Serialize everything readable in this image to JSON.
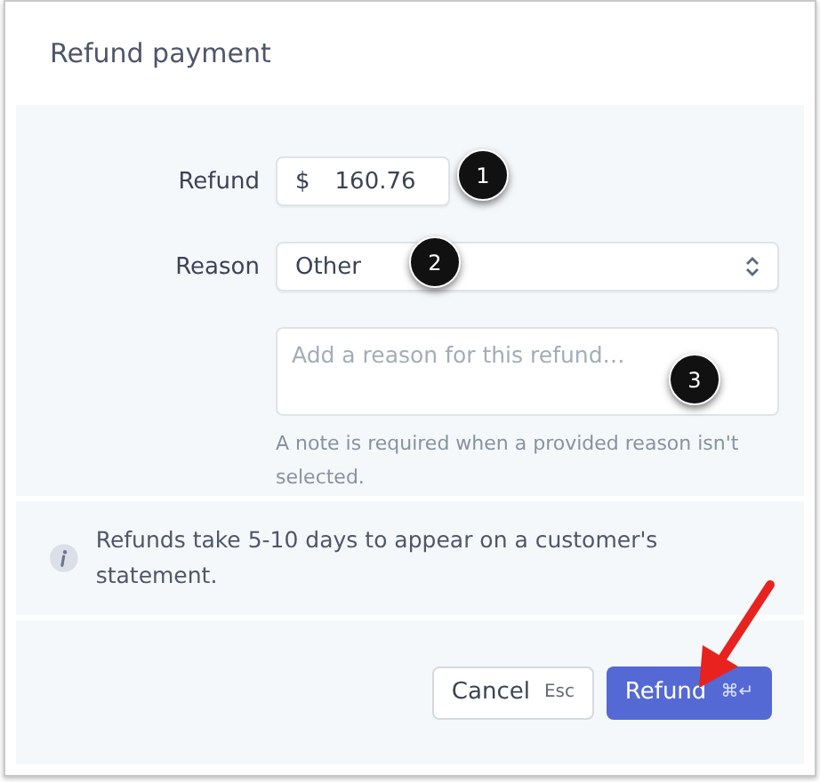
{
  "dialog": {
    "title": "Refund payment"
  },
  "refund": {
    "label": "Refund",
    "currency": "$",
    "value": "160.76"
  },
  "reason": {
    "label": "Reason",
    "value": "Other"
  },
  "note": {
    "placeholder": "Add a reason for this refund…",
    "help": "A note is required when a provided reason isn't selected."
  },
  "info": "Refunds take 5-10 days to appear on a customer's statement.",
  "buttons": [
    {
      "kind": "secondary",
      "label": "Cancel",
      "shortcut": "Esc"
    },
    {
      "kind": "primary",
      "label": "Refund",
      "shortcut": "⌘↵"
    }
  ],
  "callouts": [
    "1",
    "2",
    "3"
  ]
}
